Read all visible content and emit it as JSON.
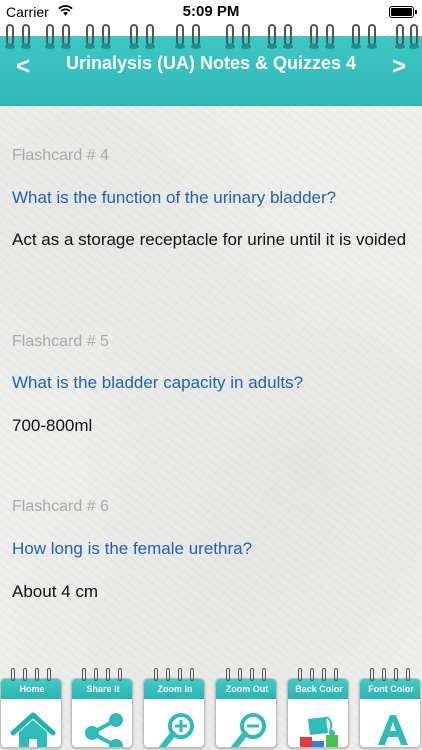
{
  "status_bar": {
    "carrier": "Carrier",
    "time": "5:09 PM"
  },
  "header": {
    "title": "Urinalysis (UA) Notes & Quizzes 4",
    "prev_label": "<",
    "next_label": ">",
    "accent_color": "#35bfbc"
  },
  "flashcards": [
    {
      "number": "Flashcard # 4",
      "question": "What is the function of the urinary bladder?",
      "answer": "Act as a storage receptacle for urine until it is voided"
    },
    {
      "number": "Flashcard # 5",
      "question": "What is the bladder capacity in adults?",
      "answer": "700-800ml"
    },
    {
      "number": "Flashcard # 6",
      "question": "How long is the female urethra?",
      "answer": "About 4 cm"
    }
  ],
  "toolbar": {
    "items": [
      {
        "label": "Home",
        "icon": "home-icon"
      },
      {
        "label": "Share it",
        "icon": "share-icon"
      },
      {
        "label": "Zoom In",
        "icon": "zoom-in-icon"
      },
      {
        "label": "Zoom Out",
        "icon": "zoom-out-icon"
      },
      {
        "label": "Back Color",
        "icon": "paint-bucket-icon"
      },
      {
        "label": "Font Color",
        "icon": "font-color-icon"
      }
    ]
  }
}
